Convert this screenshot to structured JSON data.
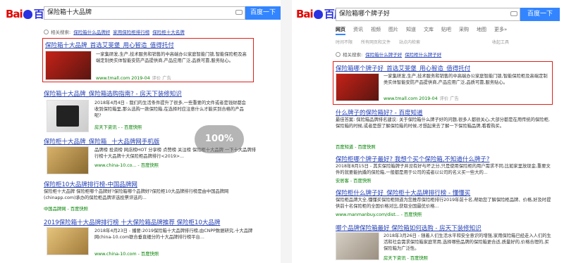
{
  "left": {
    "logo": {
      "text1": "Bai",
      "text2": "百度"
    },
    "search": {
      "query": "保险箱十大品牌",
      "button": "百度一下"
    },
    "related": {
      "label": "相关搜索:",
      "links": [
        "保险箱什么品牌好",
        "家用保险柜排行榜",
        "保险柜十大名牌"
      ]
    },
    "results": [
      {
        "title": "保险箱十大品牌_首选艾斐堡_用心智造_值得托付",
        "desc": "一家集研发,生产,技术服务和销售的中高端办公家庭智能门锁,智能保险柜及高端定制类实体智能安防产品提供商,产品应用广泛,品质可靠,服务贴心。",
        "url": "www.tmall.com 2019-04",
        "ad": "评价 广告"
      },
      {
        "title": "保险箱十大品牌_保险箱选购指南? - 房天下装修知识",
        "desc": "2018年4月4日 - 我们的生活条件提升了很多,一些重要的文件或者是钱财都会收到保险箱里,那么选购一款保险箱,在选择时应注意什么才能买到合格的产品呢?",
        "url": "房天下资讯 - - 百度快照"
      },
      {
        "title": "保险柜十大品牌_保险箱 _十大品牌网手机版",
        "desc": "品牌榜 投资榜 网店榜HOT 分享榜 点赞榜 关注榜 保险柜十大品牌 一下十大品牌排行榜十大品牌十大保险柜品牌排行<2019>...",
        "url": "www.china-10.co... - 百度快照"
      },
      {
        "title": "保险柜10大品牌排行榜-中国品牌网",
        "desc": "保险柜十大品牌 保险柜哪个品牌好?保险箱哪个品牌好?保险柜10大品牌排行榜是由中国品牌网(chinapp.com)承办的保险柜品牌评选投票评选的...",
        "url": "中国品牌网 - 百度快照"
      },
      {
        "title": "2019保险箱十大品牌排行榜 十大保险箱品牌推荐 保险柜10大品牌",
        "desc": "2018年4月23日 - 播要:2019保险箱十大品牌排行榜,由CNPP数据研究,十大品牌网china-10.com联合垂直细分的十大品牌排行榜平台...",
        "url": "www.china-10.com - 百度快照"
      }
    ],
    "zoom": "100%"
  },
  "right": {
    "logo": {
      "text1": "Bai",
      "text2": "百度"
    },
    "search": {
      "query": "保险箱哪个牌子好",
      "button": "百度一下"
    },
    "tabs": [
      "网页",
      "资讯",
      "视频",
      "图片",
      "知道",
      "文库",
      "贴吧",
      "采购",
      "地图",
      "更多»"
    ],
    "filters": [
      "时间不限",
      "所有网页和文件",
      "站点内检索",
      "收起工具"
    ],
    "related": {
      "label": "相关搜索:",
      "links": [
        "保险箱什么牌子好",
        "保险柜什么牌子好"
      ]
    },
    "results": [
      {
        "title": "保险箱哪个牌子好_首选艾斐堡_用心智造_值得托付",
        "desc": "一家集研发,生产,技术服务和销售的中高端办公家庭智能门锁,智能保险柜及高端定制类实体智能安防产品提供商,产品应用广泛,品质可靠,服务贴心。",
        "url": "www.tmall.com 2019-04",
        "ad": "评价 广告"
      },
      {
        "title": "什么牌子的保险箱好? - 百度知道",
        "desc": "最佳答案: 保险箱品牌排名建议: 关于保险箱什么牌子好的问题,很多人都很关心,大部分都是在用传统的保险柜,保险箱的时候,或者是想了解保险箱的时候,才想起来去了解一下保险箱品牌,看看购买。",
        "url": "百度知道 - 百度快照"
      },
      {
        "title": "保险柜哪个牌子最好? 我想个买个保险箱,不知道什么牌子?",
        "desc": "2018年8月15日 - 其实保险箱牌子并没有好与坏之分,只是使用保险柜的用户需求不同,比如家里放现金,重要文件的就要能抗撬的保险箱,一般都是用于公司的或者以公司的名义买一些大的...",
        "url": "安居客 - 百度快照"
      },
      {
        "title": "保险柜什么牌子好_保险柜十大品牌排行榜 - 懂懂买",
        "desc": "保险柜品牌大全,懂懂买保险柜频道为您推荐保险柜排行2019年前十名,帮助您了解保险柜品牌、价格,好及时提供前十名保险柜的全国价格对比,获取全国最优价格...",
        "url": "www.manmanbuy.com/dist... - 百度快照"
      },
      {
        "title": "哪个品牌保险箱最好 保险箱如何选购 - 房天下装修知识",
        "desc": "2018年3月26日 - 随着人们生活水平和安全意识的增强,家用保险箱已经走入人们的生活和社会需求保险箱家庭常用,选择哪些品牌的保险箱更合适,质量好的,价格合理的,买保险箱为广泛性。",
        "url": "房天下资讯 - 百度快照"
      }
    ]
  },
  "colors": {
    "link": "#2440b3",
    "keyword": "#e0201a",
    "url": "#008000",
    "button": "#3385ff",
    "highlight_box": "#e0201a"
  }
}
